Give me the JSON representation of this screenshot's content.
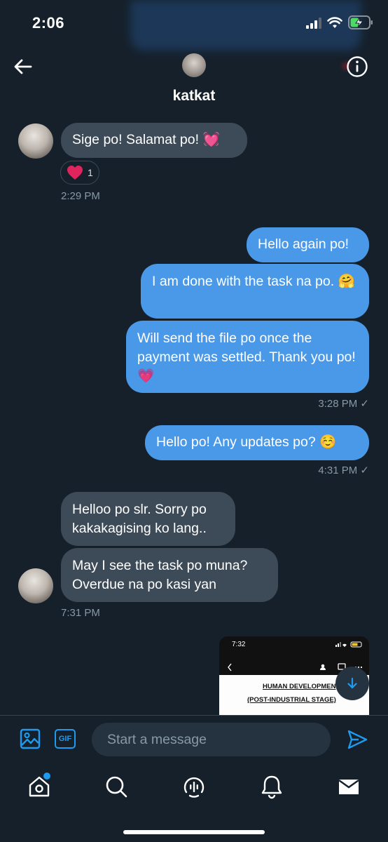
{
  "status_bar": {
    "time": "2:06"
  },
  "header": {
    "name": "katkat"
  },
  "messages": {
    "m1": "Sige po! Salamat po! 💓",
    "m1_reaction_count": "1",
    "t1": "2:29 PM",
    "m2": "Hello again po!",
    "m3": "I am done with the task na po. 🤗",
    "m4": "Will send the file po once the payment was settled. Thank you po! 💗",
    "t2": "3:28 PM ✓",
    "m5": "Hello po! Any updates po? ☺️",
    "t3": "4:31 PM ✓",
    "m6": "Helloo po slr. Sorry po kakakagising ko lang..",
    "m7": "May I see the task po muna? Overdue na po kasi yan",
    "t4": "7:31 PM"
  },
  "attachment": {
    "time": "7:32",
    "line1": "HUMAN DEVELOPMEN",
    "line2": "(POST-INDUSTRIAL STAGE)"
  },
  "composer": {
    "placeholder": "Start a message",
    "gif_label": "GIF"
  },
  "colors": {
    "background": "#15202b",
    "outgoing": "#4a99e9",
    "incoming": "#3d4a57",
    "accent": "#1d9bf0"
  },
  "icons": [
    "back-arrow-icon",
    "info-icon",
    "heart-icon",
    "image-icon",
    "gif-icon",
    "send-icon",
    "home-icon",
    "search-icon",
    "spaces-icon",
    "bell-icon",
    "mail-icon",
    "arrow-down-icon"
  ]
}
